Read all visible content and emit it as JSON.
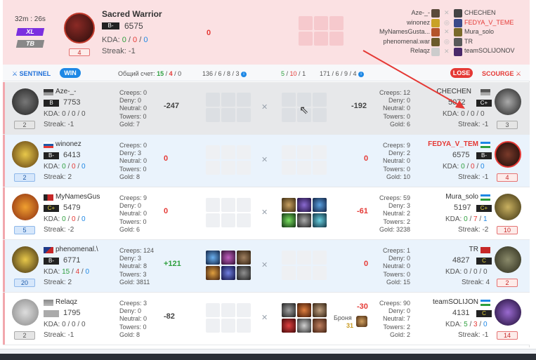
{
  "header": {
    "timer": "32m : 26s",
    "badge_xl": "XL",
    "badge_tb": "TB",
    "main_player": {
      "name": "Sacred Warrior",
      "medal": "B-",
      "mmr": "6575",
      "kda_k": "0",
      "kda_d": "0",
      "kda_a": "0",
      "kda_label": "KDA:",
      "streak": "Streak: -1",
      "rank": "4",
      "score": "0"
    },
    "roster_left": [
      "Aze-_-",
      "winonez",
      "MyNamesGusta...",
      "phenomenal.war",
      "Relaqz"
    ],
    "roster_right": [
      "CHECHEN",
      "FEDYA_V_TEME",
      "Mura_solo",
      "TR",
      "teamSOLIJONOV"
    ]
  },
  "teambar": {
    "sentinel": "SENTINEL",
    "win": "WIN",
    "score_label": "Общий счет:",
    "score_a": "15",
    "score_b": "4",
    "score_c": "0",
    "left_stats": "136 / 6 / 8 / 3",
    "mid_a": "5",
    "mid_b": "10",
    "mid_c": "1",
    "right_stats": "171 / 6 / 9 / 4",
    "lose": "LOSE",
    "scourge": "SCOURGE"
  },
  "rows": [
    {
      "left": {
        "name": "Aze-_-",
        "medal": "B",
        "mmr": "7753",
        "k": "0",
        "d": "0",
        "a": "0",
        "streak": "Streak: -1",
        "rank": "2",
        "creeps": "Creeps: 0",
        "deny": "Deny: 0",
        "neutral": "Neutral: 0",
        "towers": "Towers: 0",
        "gold": "Gold: 7"
      },
      "left_diff": "-247",
      "right_diff": "-192",
      "right": {
        "name": "CHECHEN",
        "medal": "C+",
        "mmr": "5072",
        "k": "0",
        "d": "0",
        "a": "0",
        "streak": "Streak: -1",
        "rank": "3",
        "creeps": "Creeps: 12",
        "deny": "Deny: 0",
        "neutral": "Neutral: 0",
        "towers": "Towers: 0",
        "gold": "Gold: 6"
      }
    },
    {
      "left": {
        "name": "winonez",
        "medal": "B-",
        "mmr": "6413",
        "k": "0",
        "d": "0",
        "a": "0",
        "streak": "Streak: 2",
        "rank": "2",
        "creeps": "Creeps: 0",
        "deny": "Deny: 3",
        "neutral": "Neutral: 0",
        "towers": "Towers: 0",
        "gold": "Gold: 8"
      },
      "left_diff": "0",
      "right_diff": "0",
      "right": {
        "name": "FEDYA_V_TEM",
        "medal": "B-",
        "mmr": "6575",
        "k": "0",
        "d": "0",
        "a": "0",
        "streak": "Streak: -1",
        "rank": "4",
        "creeps": "Creeps: 9",
        "deny": "Deny: 2",
        "neutral": "Neutral: 0",
        "towers": "Towers: 0",
        "gold": "Gold: 10"
      }
    },
    {
      "left": {
        "name": "MyNamesGus",
        "medal": "C+",
        "mmr": "5479",
        "k": "0",
        "d": "0",
        "a": "0",
        "streak": "Streak: -2",
        "rank": "5",
        "creeps": "Creeps: 9",
        "deny": "Deny: 0",
        "neutral": "Neutral: 0",
        "towers": "Towers: 0",
        "gold": "Gold: 6"
      },
      "left_diff": "0",
      "right_diff": "-61",
      "right": {
        "name": "Mura_solo",
        "medal": "C+",
        "mmr": "5197",
        "k": "0",
        "d": "7",
        "a": "1",
        "streak": "Streak: -2",
        "rank": "10",
        "creeps": "Creeps: 59",
        "deny": "Deny: 3",
        "neutral": "Neutral: 2",
        "towers": "Towers: 2",
        "gold": "Gold: 3238"
      }
    },
    {
      "left": {
        "name": "phenomenal.\\",
        "medal": "B-",
        "mmr": "6771",
        "k": "15",
        "d": "4",
        "a": "0",
        "streak": "Streak: 2",
        "rank": "20",
        "creeps": "Creeps: 124",
        "deny": "Deny: 3",
        "neutral": "Neutral: 8",
        "towers": "Towers: 3",
        "gold": "Gold: 3811"
      },
      "left_diff": "+121",
      "right_diff": "0",
      "right": {
        "name": "TR",
        "medal": "C",
        "mmr": "4827",
        "k": "0",
        "d": "0",
        "a": "0",
        "streak": "Streak: 4",
        "rank": "2",
        "creeps": "Creeps: 1",
        "deny": "Deny: 0",
        "neutral": "Neutral: 0",
        "towers": "Towers: 0",
        "gold": "Gold: 15"
      }
    },
    {
      "left": {
        "name": "Relaqz",
        "medal": "",
        "mmr": "1795",
        "k": "0",
        "d": "0",
        "a": "0",
        "streak": "Streak: -1",
        "rank": "2",
        "creeps": "Creeps: 3",
        "deny": "Deny: 0",
        "neutral": "Neutral: 0",
        "towers": "Towers: 0",
        "gold": "Gold: 8"
      },
      "left_diff": "-82",
      "right_diff": "-30",
      "bronya": "Броня",
      "bronya_val": "31",
      "right": {
        "name": "teamSOLIJON",
        "medal": "C",
        "mmr": "4131",
        "k": "5",
        "d": "3",
        "a": "0",
        "streak": "Streak: -1",
        "rank": "14",
        "creeps": "Creeps: 90",
        "deny": "Deny: 0",
        "neutral": "Neutral: 7",
        "towers": "Towers: 2",
        "gold": "Gold: 2"
      }
    }
  ],
  "colors": {
    "green": "#2e9f3e",
    "red": "#e53935",
    "blue": "#1e88e5",
    "purple": "#7b2fe0"
  },
  "icons": {
    "sentinel": "crossed-swords-icon",
    "scourge": "crossed-swords-icon",
    "versus": "swords-icon",
    "info": "info-icon"
  }
}
